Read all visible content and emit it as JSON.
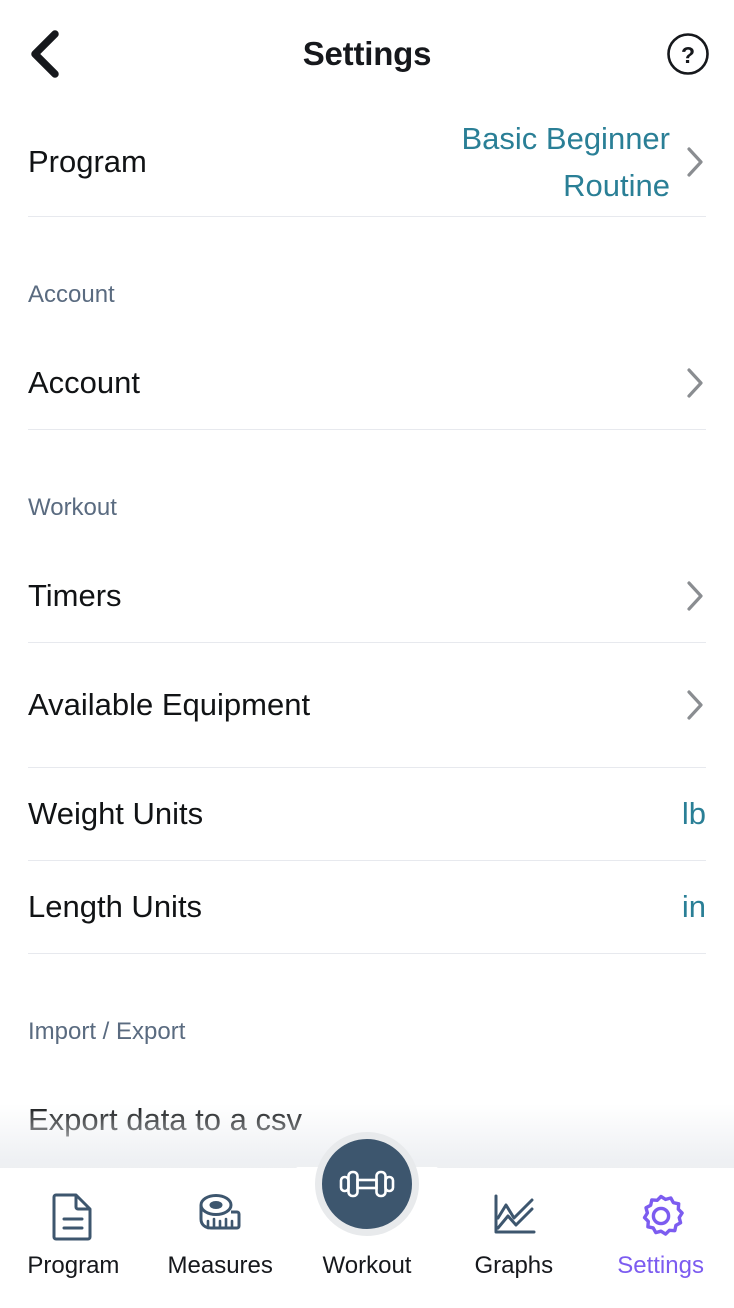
{
  "header": {
    "title": "Settings",
    "back_icon": "chevron-left-icon",
    "help_icon": "question-circle-icon"
  },
  "colors": {
    "accent_teal": "#2a7f96",
    "active_purple": "#7c5cf0",
    "section_header": "#5a6b80",
    "fab_bg": "#3d566e",
    "divider": "#e7e9ee"
  },
  "sections": [
    {
      "id": "program",
      "header": null,
      "rows": [
        {
          "label": "Program",
          "value": "Basic Beginner Routine",
          "value_color": "teal",
          "chevron": true,
          "two_line_value": true
        }
      ]
    },
    {
      "id": "account",
      "header": "Account",
      "rows": [
        {
          "label": "Account",
          "value": "",
          "chevron": true
        }
      ]
    },
    {
      "id": "workout",
      "header": "Workout",
      "rows": [
        {
          "label": "Timers",
          "value": "",
          "chevron": true
        },
        {
          "label": "Available Equipment",
          "value": "",
          "chevron": true,
          "two_line_label": true
        },
        {
          "label": "Weight Units",
          "value": "lb",
          "value_color": "teal",
          "chevron": false
        },
        {
          "label": "Length Units",
          "value": "in",
          "value_color": "teal",
          "chevron": false
        }
      ]
    },
    {
      "id": "import-export",
      "header": "Import / Export",
      "rows": [
        {
          "label": "Export data to a csv",
          "value": "",
          "chevron": false,
          "clipped": true
        }
      ]
    }
  ],
  "tabbar": {
    "items": [
      {
        "label": "Program",
        "icon": "document-icon",
        "active": false
      },
      {
        "label": "Measures",
        "icon": "tape-measure-icon",
        "active": false
      },
      {
        "label": "Workout",
        "icon": "dumbbell-icon",
        "active": false,
        "center": true
      },
      {
        "label": "Graphs",
        "icon": "line-chart-icon",
        "active": false
      },
      {
        "label": "Settings",
        "icon": "gear-icon",
        "active": true
      }
    ]
  }
}
